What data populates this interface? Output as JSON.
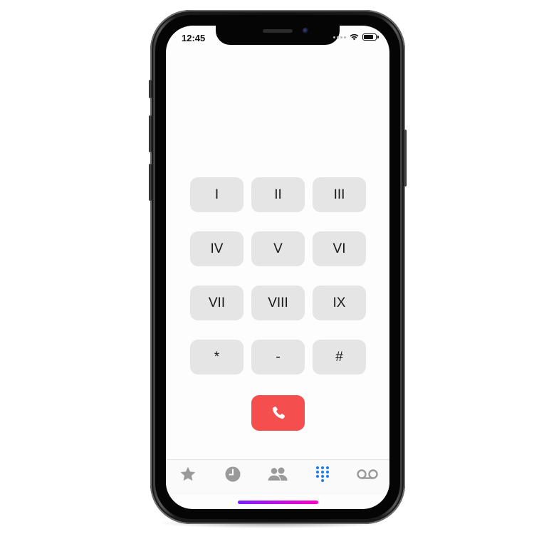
{
  "status_bar": {
    "time": "12:45",
    "icons": [
      "signal-dots-icon",
      "wifi-icon",
      "battery-icon"
    ],
    "battery_level": 0.9
  },
  "keypad": {
    "keys": [
      "I",
      "II",
      "III",
      "IV",
      "V",
      "VI",
      "VII",
      "VIII",
      "IX",
      "*",
      "-",
      "#"
    ]
  },
  "call_button": {
    "icon": "phone-icon",
    "color": "#f54e4f"
  },
  "tab_bar": {
    "tabs": [
      {
        "name": "favorites",
        "icon": "star-icon",
        "active": false
      },
      {
        "name": "recents",
        "icon": "clock-icon",
        "active": false
      },
      {
        "name": "contacts",
        "icon": "contacts-icon",
        "active": false
      },
      {
        "name": "keypad",
        "icon": "keypad-icon",
        "active": true
      },
      {
        "name": "voicemail",
        "icon": "voicemail-icon",
        "active": false
      }
    ],
    "active_color": "#1a7cf5",
    "inactive_color": "#9a9a9a"
  }
}
